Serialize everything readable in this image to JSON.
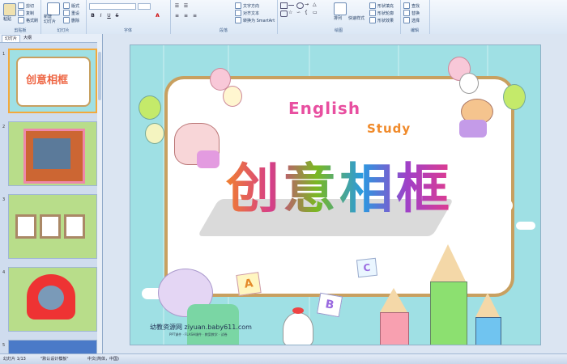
{
  "ribbon": {
    "clipboard": {
      "paste": "粘贴",
      "cut": "剪切",
      "copy": "复制",
      "format_painter": "格式刷",
      "label": "剪贴板"
    },
    "slides": {
      "new_slide": "新建\n幻灯片",
      "layout": "版式",
      "reset": "重设",
      "delete": "删除",
      "label": "幻灯片"
    },
    "font": {
      "label": "字体",
      "bold": "B",
      "italic": "I",
      "underline": "U",
      "strike": "S"
    },
    "paragraph": {
      "label": "段落"
    },
    "drawing": {
      "arrange": "排列",
      "quick_styles": "快速样式",
      "fill": "形状填充",
      "outline": "形状轮廓",
      "effects": "形状效果",
      "label": "绘图"
    },
    "text_opts": {
      "direction": "文字方向",
      "align": "对齐文本",
      "smartart": "转换为 SmartArt"
    },
    "editing": {
      "find": "查找",
      "replace": "替换",
      "select": "选择",
      "label": "编辑"
    }
  },
  "pane": {
    "tabs": [
      "幻灯片",
      "大纲"
    ],
    "slides": [
      {
        "num": "1"
      },
      {
        "num": "2"
      },
      {
        "num": "3"
      },
      {
        "num": "4"
      },
      {
        "num": "5"
      }
    ]
  },
  "slide": {
    "english": "English",
    "study": "Study",
    "title": "创意相框",
    "watermark": "幼教资源网 ziyuan.baby611.com",
    "watermark_sub": "PPT课件 · FLASH课件 · 教案教学 · 试卷",
    "letters": [
      "A",
      "B",
      "C"
    ]
  },
  "status": {
    "slide": "幻灯片 1/13",
    "theme": "\"默认设计模板\"",
    "lang": "中文(简体，中国)"
  },
  "colors": {
    "slide_bg": "#9fe0e4",
    "frame": "#c8a060",
    "ribbon": "#dbe7f5"
  }
}
